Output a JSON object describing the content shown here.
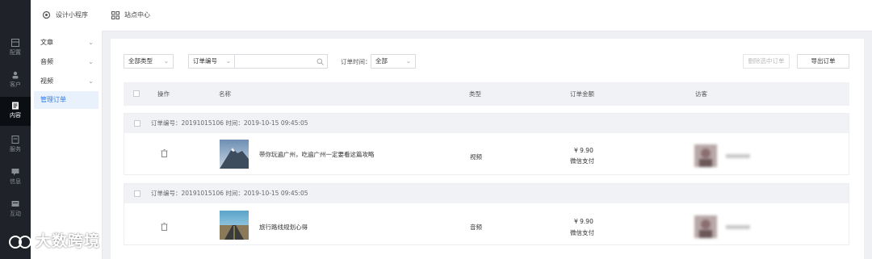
{
  "rail": {
    "items": [
      {
        "label": "配置",
        "icon": "layout-icon"
      },
      {
        "label": "客户",
        "icon": "users-icon"
      },
      {
        "label": "内容",
        "icon": "document-icon",
        "active": true
      },
      {
        "label": "服务",
        "icon": "service-icon"
      },
      {
        "label": "信息",
        "icon": "message-icon"
      },
      {
        "label": "互动",
        "icon": "chat-icon"
      }
    ]
  },
  "topbar": {
    "tab1": "设计小程序",
    "tab2": "站点中心"
  },
  "sidebar": {
    "items": [
      {
        "label": "文章",
        "expandable": true
      },
      {
        "label": "音频",
        "expandable": true
      },
      {
        "label": "视频",
        "expandable": true
      },
      {
        "label": "管理订单",
        "active": true
      }
    ]
  },
  "filters": {
    "type_select": "全部类型",
    "field_select": "订单编号",
    "search_placeholder": "",
    "time_label": "订单时间：",
    "time_select": "全部",
    "delete_button": "删除选中订单",
    "export_button": "导出订单"
  },
  "table": {
    "headers": [
      "操作",
      "名称",
      "类型",
      "订单金额",
      "访客"
    ]
  },
  "orders": [
    {
      "header": "订单编号：20191015106   时间：2019-10-15 09:45:05",
      "name": "带你玩遍广州，吃遍广州一定要看这篇攻略",
      "type": "视频",
      "amount": "¥ 9.90",
      "pay": "微信支付",
      "visitor": "Jack Wu"
    },
    {
      "header": "订单编号：20191015106   时间：2019-10-15 09:45:05",
      "name": "旅行路线规划心得",
      "type": "音频",
      "amount": "¥ 9.90",
      "pay": "微信支付",
      "visitor": "Jack Wu"
    }
  ],
  "watermark": "大数跨境",
  "colors": {
    "accent": "#2f7bea",
    "rail": "#1f2329"
  }
}
